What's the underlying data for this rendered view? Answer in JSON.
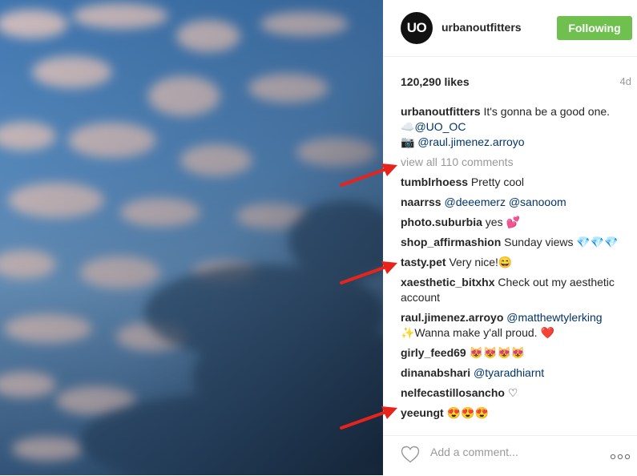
{
  "post": {
    "avatar_text": "UO",
    "username": "urbanoutfitters",
    "follow_label": "Following",
    "likes": "120,290 likes",
    "age": "4d"
  },
  "caption": {
    "user": "urbanoutfitters",
    "text": "It's gonna be a good one.",
    "line2_emoji": "☁️",
    "line2_mention": "@UO_OC",
    "line3_emoji": "📷",
    "line3_mention": "@raul.jimenez.arroyo"
  },
  "view_all": "view all 110 comments",
  "comments": [
    {
      "user": "tumblrhoess",
      "text": "Pretty cool"
    },
    {
      "user": "naarrss",
      "mention": "@deeemerz @sanooom"
    },
    {
      "user": "photo.suburbia",
      "text": "yes 💕"
    },
    {
      "user": "shop_affirmashion",
      "text": "Sunday views 💎💎💎"
    },
    {
      "user": "tasty.pet",
      "text": "Very nice!😄"
    },
    {
      "user": "xaesthetic_bitxhx",
      "text": "Check out my aesthetic account"
    },
    {
      "user": "raul.jimenez.arroyo",
      "mention": "@matthewtylerking",
      "text": "✨Wanna make y'all proud. ❤️"
    },
    {
      "user": "girly_feed69",
      "text": "😻😻😻😻"
    },
    {
      "user": "dinanabshari",
      "mention": "@tyaradhiarnt"
    },
    {
      "user": "nelfecastillosancho",
      "text": "♡"
    },
    {
      "user": "yeeungt",
      "text": "😍😍😍"
    }
  ],
  "footer": {
    "placeholder": "Add a comment...",
    "like_icon": "heart-outline-icon",
    "more_icon": "more-options-icon"
  },
  "colors": {
    "follow_bg": "#70c050",
    "link": "#003569",
    "annotation_arrow": "#e8231c"
  }
}
